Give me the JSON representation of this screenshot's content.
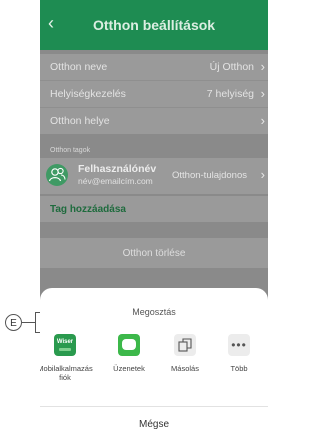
{
  "header": {
    "back_icon": "chevron-left-icon",
    "title": "Otthon beállítások"
  },
  "settings": [
    {
      "label": "Otthon neve",
      "value": "Új Otthon"
    },
    {
      "label": "Helyiségkezelés",
      "value": "7 helyiség"
    },
    {
      "label": "Otthon helye",
      "value": ""
    }
  ],
  "members": {
    "section_label": "Otthon tagok",
    "user_name": "Felhasználónév",
    "user_email": "név@emailcím.com",
    "role": "Otthon-tulajdonos",
    "add_label": "Tag hozzáadása"
  },
  "delete_label": "Otthon törlése",
  "share_sheet": {
    "title": "Megosztás",
    "options": [
      {
        "label": "Mobilalkalmazás fiók",
        "icon": "wiser-app-icon"
      },
      {
        "label": "Üzenetek",
        "icon": "messages-icon"
      },
      {
        "label": "Másolás",
        "icon": "copy-icon"
      },
      {
        "label": "Több",
        "icon": "more-icon"
      }
    ],
    "app_icon_text": "Wiser",
    "cancel_label": "Mégse"
  },
  "callout": {
    "letter": "E"
  },
  "colors": {
    "brand_green": "#1e8c52",
    "overlay_gray": "#8a8a8a"
  }
}
